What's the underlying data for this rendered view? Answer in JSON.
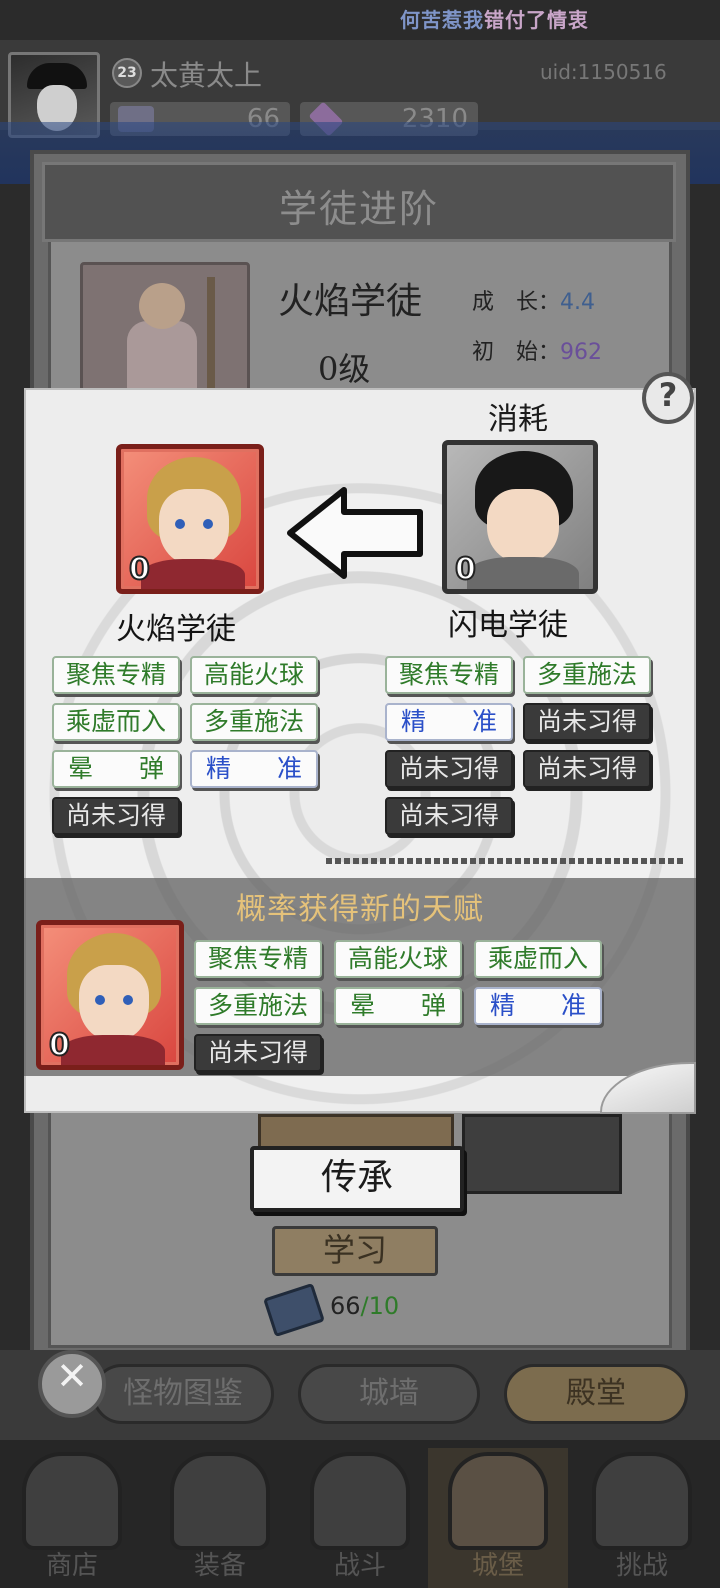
{
  "marquee": {
    "part1": "何苦惹我",
    "part2": "错付了情衷"
  },
  "player": {
    "level": "23",
    "name": "太黄太上",
    "uid": "uid:1150516"
  },
  "resources": [
    {
      "icon": "wing-icon",
      "value": "66"
    },
    {
      "icon": "gem-icon",
      "value": "2310"
    }
  ],
  "panel": {
    "title": "学徒进阶",
    "hero_name": "火焰学徒",
    "hero_level": "0级",
    "growth_label": "成　长：",
    "growth_value": "4.4",
    "init_label": "初　始：",
    "init_value": "962"
  },
  "modal": {
    "help": "?",
    "consume_label": "消耗",
    "target": {
      "name": "火焰学徒",
      "level": "0"
    },
    "source": {
      "name": "闪电学徒",
      "level": "0"
    },
    "target_talents": [
      {
        "text": "聚焦专精",
        "style": "green"
      },
      {
        "text": "高能火球",
        "style": "green"
      },
      {
        "text": "乘虚而入",
        "style": "green"
      },
      {
        "text": "多重施法",
        "style": "green"
      },
      {
        "text": "晕弹",
        "parts": [
          "晕",
          "弹"
        ],
        "style": "green"
      },
      {
        "text": "精准",
        "parts": [
          "精",
          "准"
        ],
        "style": "blue"
      },
      {
        "text": "尚未习得",
        "style": "dark"
      }
    ],
    "source_talents": [
      {
        "text": "聚焦专精",
        "style": "green"
      },
      {
        "text": "多重施法",
        "style": "green"
      },
      {
        "text": "精准",
        "parts": [
          "精",
          "准"
        ],
        "style": "blue"
      },
      {
        "text": "尚未习得",
        "style": "dark"
      },
      {
        "text": "尚未习得",
        "style": "dark"
      },
      {
        "text": "尚未习得",
        "style": "dark"
      },
      {
        "text": "尚未习得",
        "style": "dark"
      }
    ],
    "new_talent_title": "概率获得新的天赋",
    "result": {
      "level": "0"
    },
    "result_talents": [
      {
        "text": "聚焦专精",
        "style": "green"
      },
      {
        "text": "高能火球",
        "style": "green"
      },
      {
        "text": "乘虚而入",
        "style": "green"
      },
      {
        "text": "多重施法",
        "style": "green"
      },
      {
        "text": "晕弹",
        "parts": [
          "晕",
          "弹"
        ],
        "style": "green"
      },
      {
        "text": "精准",
        "parts": [
          "精",
          "准"
        ],
        "style": "blue"
      },
      {
        "text": "尚未习得",
        "style": "dark"
      }
    ]
  },
  "actions": {
    "inherit": "传承",
    "learn": "学习",
    "book_count": "66",
    "book_max": "10"
  },
  "sub_tabs": {
    "monster": "怪物图鉴",
    "wall": "城墙",
    "hall": "殿堂",
    "close": "✕"
  },
  "nav": {
    "shop": "商店",
    "equip": "装备",
    "battle": "战斗",
    "castle": "城堡",
    "challenge": "挑战"
  },
  "colors": {
    "green_talent": "#2f7b2a",
    "blue_talent": "#2a4fc8",
    "new_talent_title": "#e5c27a",
    "growth_value": "#3f5f8f",
    "init_value": "#6a4f9a"
  }
}
